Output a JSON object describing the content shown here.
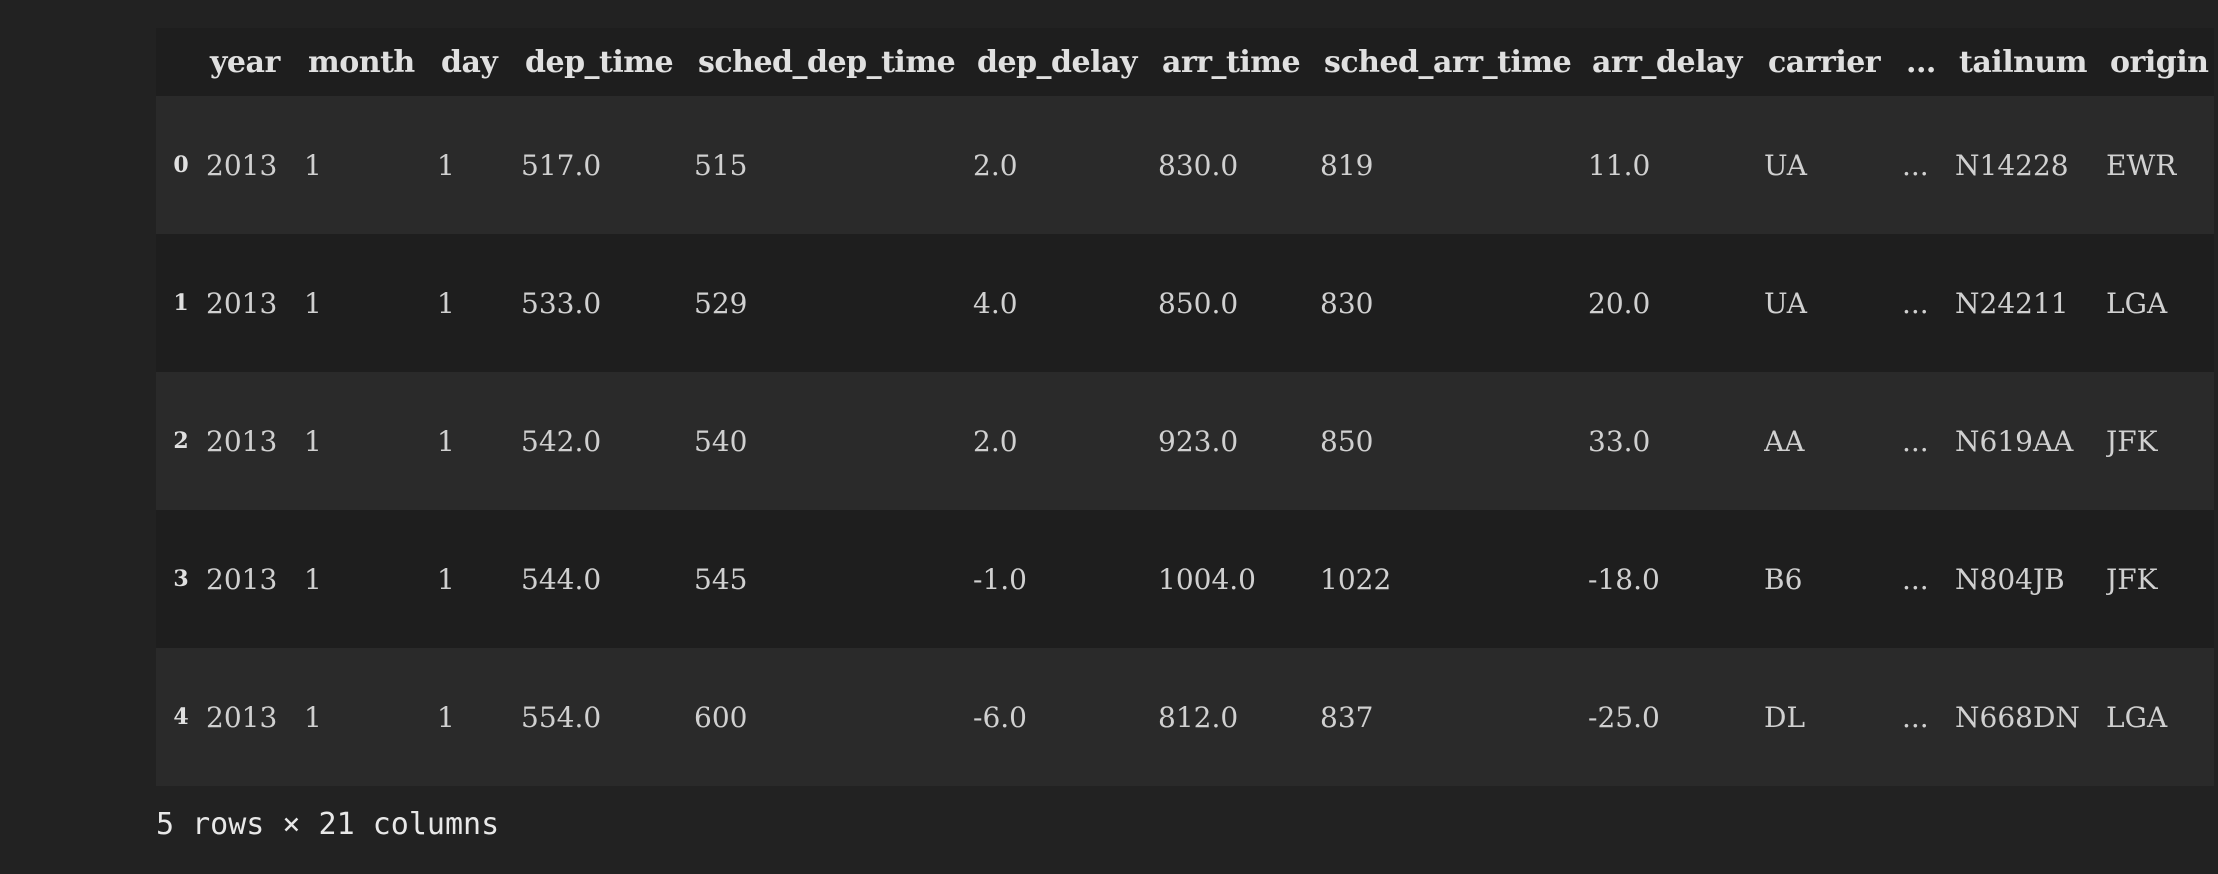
{
  "table": {
    "columns": [
      "year",
      "month",
      "day",
      "dep_time",
      "sched_dep_time",
      "dep_delay",
      "arr_time",
      "sched_arr_time",
      "arr_delay",
      "carrier",
      "...",
      "tailnum",
      "origin"
    ],
    "rows": [
      {
        "index": "0",
        "cells": [
          "2013",
          "1",
          "1",
          "517.0",
          "515",
          "2.0",
          "830.0",
          "819",
          "11.0",
          "UA",
          "...",
          "N14228",
          "EWR"
        ]
      },
      {
        "index": "1",
        "cells": [
          "2013",
          "1",
          "1",
          "533.0",
          "529",
          "4.0",
          "850.0",
          "830",
          "20.0",
          "UA",
          "...",
          "N24211",
          "LGA"
        ]
      },
      {
        "index": "2",
        "cells": [
          "2013",
          "1",
          "1",
          "542.0",
          "540",
          "2.0",
          "923.0",
          "850",
          "33.0",
          "AA",
          "...",
          "N619AA",
          "JFK"
        ]
      },
      {
        "index": "3",
        "cells": [
          "2013",
          "1",
          "1",
          "544.0",
          "545",
          "-1.0",
          "1004.0",
          "1022",
          "-18.0",
          "B6",
          "...",
          "N804JB",
          "JFK"
        ]
      },
      {
        "index": "4",
        "cells": [
          "2013",
          "1",
          "1",
          "554.0",
          "600",
          "-6.0",
          "812.0",
          "837",
          "-25.0",
          "DL",
          "...",
          "N668DN",
          "LGA"
        ]
      }
    ]
  },
  "footer": {
    "summary": "5 rows × 21 columns"
  }
}
